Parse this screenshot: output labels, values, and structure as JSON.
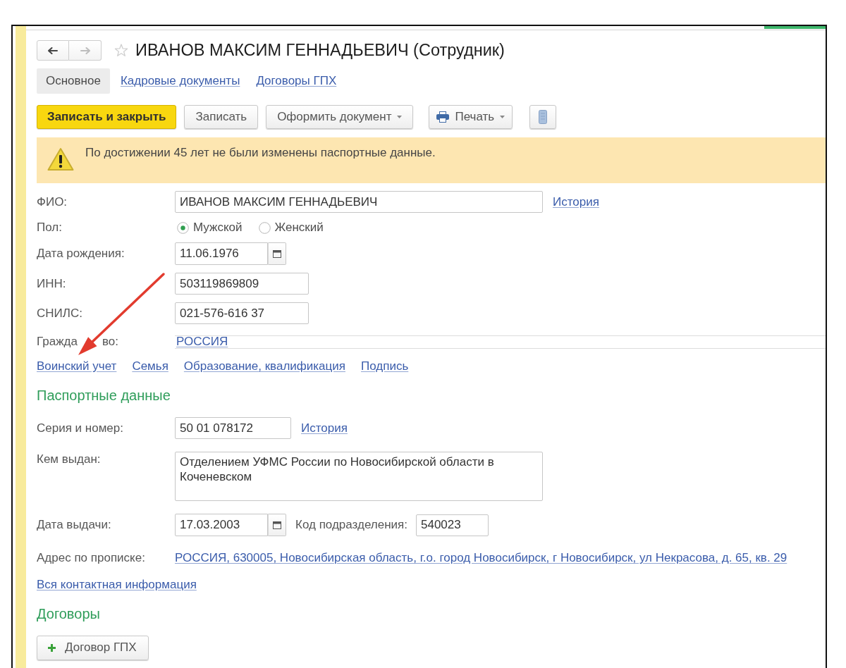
{
  "window": {
    "title": "ИВАНОВ МАКСИМ ГЕННАДЬЕВИЧ (Сотрудник)",
    "favorite": false
  },
  "nav": {
    "back_disabled": false,
    "forward_disabled": true
  },
  "tabs": [
    {
      "label": "Основное",
      "selected": true
    },
    {
      "label": "Кадровые документы",
      "selected": false
    },
    {
      "label": "Договоры ГПХ",
      "selected": false
    }
  ],
  "toolbar": [
    {
      "kind": "primary",
      "label": "Записать и закрыть"
    },
    {
      "kind": "plain",
      "label": "Записать"
    },
    {
      "kind": "menu",
      "label": "Оформить документ"
    },
    {
      "kind": "print_menu",
      "label": "Печать"
    },
    {
      "kind": "icon_only"
    }
  ],
  "warning": {
    "text": "По достижении 45 лет не были изменены паспортные данные."
  },
  "person": [
    {
      "kind": "wide_text",
      "label": "ФИО:",
      "value": "ИВАНОВ МАКСИМ ГЕННАДЬЕВИЧ",
      "link": "История"
    },
    {
      "kind": "radio",
      "label": "Пол:",
      "options": [
        {
          "label": "Мужской",
          "selected": true
        },
        {
          "label": "Женский",
          "selected": false
        }
      ]
    },
    {
      "kind": "date",
      "label": "Дата рождения:",
      "value": "11.06.1976"
    },
    {
      "kind": "text",
      "label": "ИНН:",
      "value": "503119869809"
    },
    {
      "kind": "text",
      "label": "СНИЛС:",
      "value": "021-576-616 37"
    },
    {
      "kind": "link_field",
      "label": "Гражда",
      "label_tail": "во:",
      "value": "РОССИЯ"
    }
  ],
  "person_links": [
    "Воинский учет",
    "Семья",
    "Образование, квалификация",
    "Подпись"
  ],
  "passport": {
    "title": "Паспортные данные",
    "rows": [
      {
        "kind": "text",
        "label": "Серия и номер:",
        "value": "50 01 078172",
        "link": "История"
      },
      {
        "kind": "textarea",
        "label": "Кем выдан:",
        "value": "Отделением УФМС России по Новосибирской области в Коченевском"
      },
      {
        "kind": "date",
        "label": "Дата выдачи:",
        "value": "17.03.2003",
        "extra_label": "Код подразделения:",
        "extra_value": "540023"
      },
      {
        "kind": "link",
        "label": "Адрес по прописке:",
        "value": "РОССИЯ, 630005, Новосибирская область, г.о. город Новосибирск, г Новосибирск, ул Некрасова, д. 65, кв. 29"
      }
    ]
  },
  "contact_link": "Вся контактная информация",
  "contracts": {
    "title": "Договоры",
    "button": "Договор ГПХ"
  },
  "annotations": [
    {
      "kind": "arrow"
    }
  ]
}
